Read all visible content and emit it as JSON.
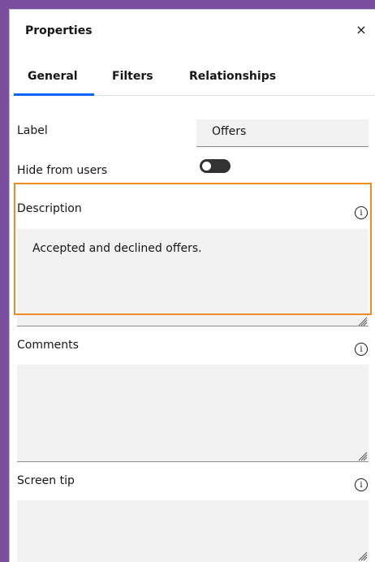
{
  "panel": {
    "title": "Properties",
    "close_label": "×"
  },
  "tabs": [
    {
      "label": "General",
      "active": true
    },
    {
      "label": "Filters",
      "active": false
    },
    {
      "label": "Relationships",
      "active": false
    }
  ],
  "fields": {
    "label": {
      "label": "Label",
      "value": "Offers"
    },
    "hide_from_users": {
      "label": "Hide from users",
      "enabled": false
    },
    "description": {
      "label": "Description",
      "value": "Accepted and declined offers."
    },
    "comments": {
      "label": "Comments",
      "value": ""
    },
    "screen_tip": {
      "label": "Screen tip",
      "value": ""
    }
  },
  "icons": {
    "info": "info-icon",
    "info_glyph": "i",
    "close": "close-icon",
    "resize": "resize-handle-icon"
  },
  "colors": {
    "accent": "#0f62fe",
    "focus": "#f08a24",
    "background": "#7a4fa0",
    "field_bg": "#f2f2f2",
    "toggle_off": "#333333"
  }
}
